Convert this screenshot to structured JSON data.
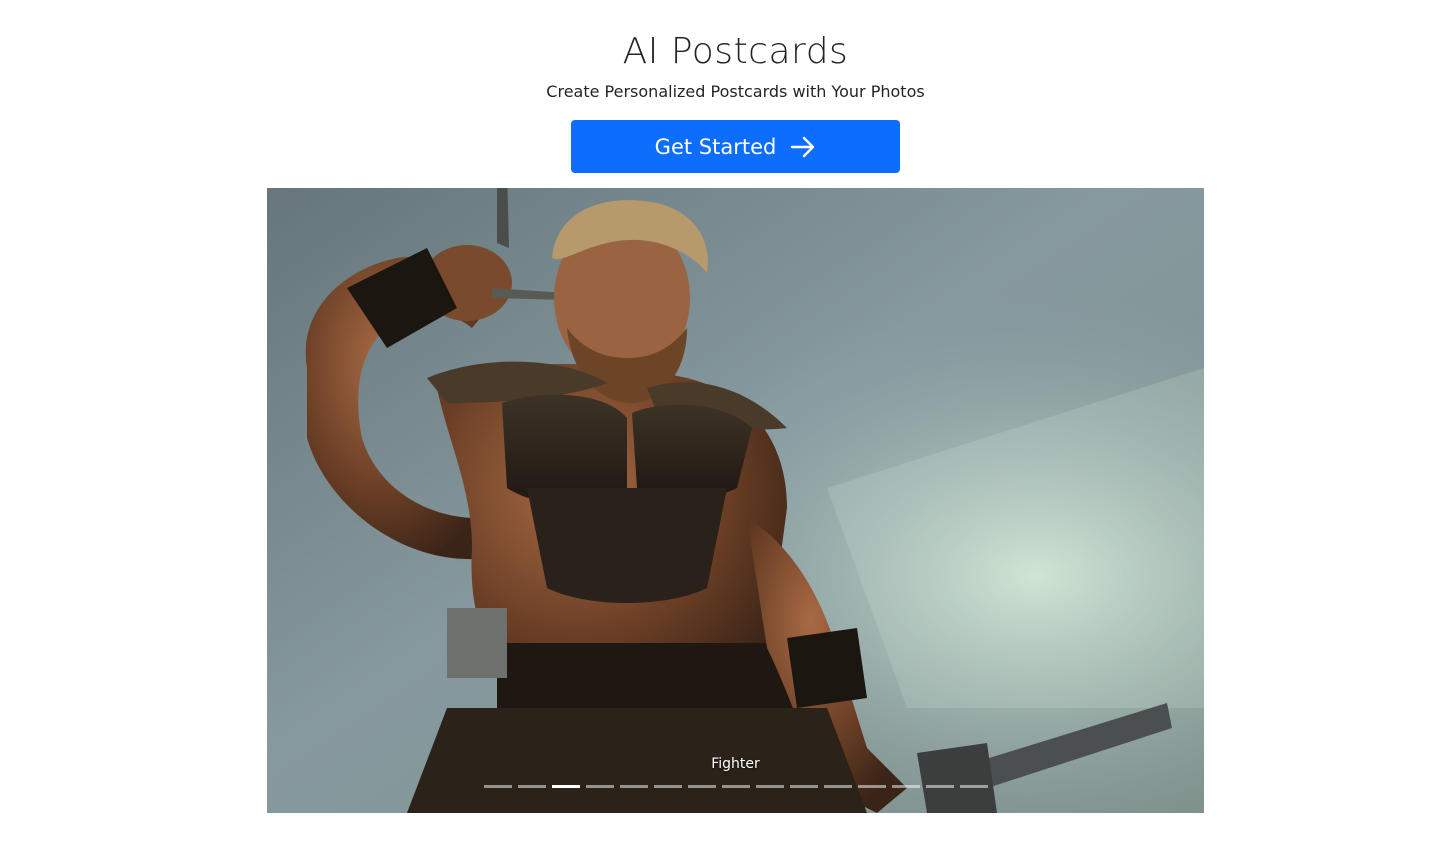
{
  "header": {
    "title": "AI Postcards",
    "subtitle": "Create Personalized Postcards with Your Photos"
  },
  "cta": {
    "label": "Get Started",
    "icon": "arrow-right-icon",
    "color": "#0d6efd"
  },
  "carousel": {
    "caption": "Fighter",
    "indicator_count": 15,
    "active_index": 2
  }
}
